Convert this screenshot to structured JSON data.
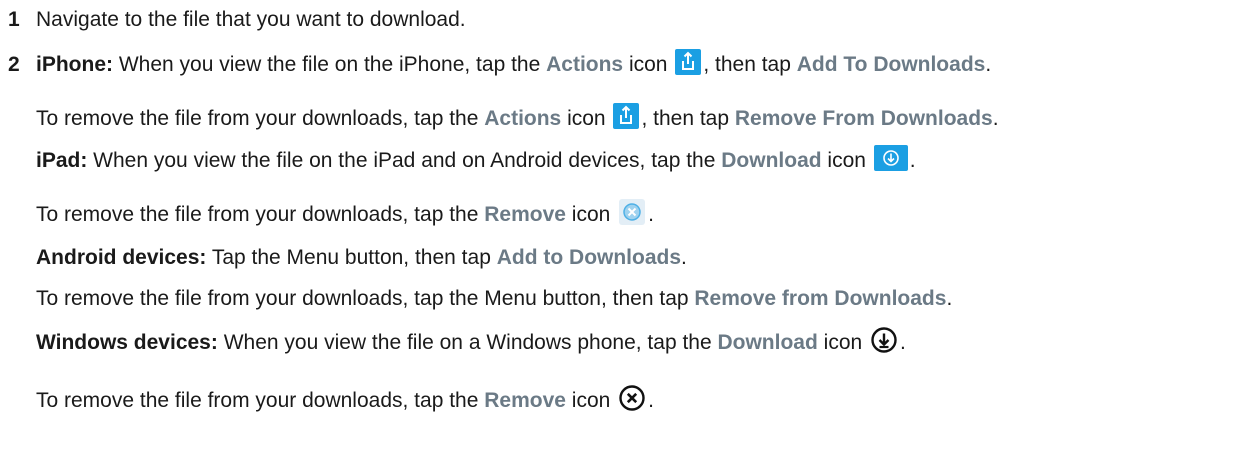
{
  "steps": [
    {
      "number": "1",
      "text": "Navigate to the file that you want to download."
    },
    {
      "number": "2",
      "iphone_label": "iPhone:",
      "iphone_text1": " When you view the file on the iPhone, tap the ",
      "actions": "Actions",
      "icon_word": " icon ",
      "then_tap": ", then tap ",
      "add_to_downloads": "Add To Downloads",
      "period": "."
    }
  ],
  "iphone_remove": {
    "text1": "To remove the file from your downloads, tap the ",
    "actions": "Actions",
    "icon_word": " icon ",
    "then_tap": ", then tap ",
    "remove_from_downloads": "Remove From Downloads",
    "period": "."
  },
  "ipad": {
    "label": "iPad:",
    "text1": " When you view the file on the iPad and on Android devices, tap the ",
    "download": "Download",
    "icon_word": " icon ",
    "period": "."
  },
  "ipad_remove": {
    "text1": "To remove the file from your downloads, tap the ",
    "remove": "Remove",
    "icon_word": " icon ",
    "period": "."
  },
  "android": {
    "label": "Android devices:",
    "text1": " Tap the Menu button, then tap ",
    "add_to_downloads": "Add to Downloads",
    "period": "."
  },
  "android_remove": {
    "text1": "To remove the file from your downloads, tap the Menu button, then tap ",
    "remove_from_downloads": "Remove from Downloads",
    "period": "."
  },
  "windows": {
    "label": "Windows devices:",
    "text1": " When you view the file on a Windows phone, tap the ",
    "download": "Download",
    "icon_word": " icon ",
    "period": "."
  },
  "windows_remove": {
    "text1": "To remove the file from your downloads, tap the ",
    "remove": "Remove",
    "icon_word": " icon ",
    "period": "."
  },
  "icons": {
    "actions": "share-icon",
    "download_ios": "download-icon",
    "remove_ios": "remove-icon",
    "download_windows": "download-circle-icon",
    "remove_windows": "close-circle-icon"
  },
  "colors": {
    "ui_text": "#6b7a86",
    "icon_blue": "#1b9fe3"
  }
}
